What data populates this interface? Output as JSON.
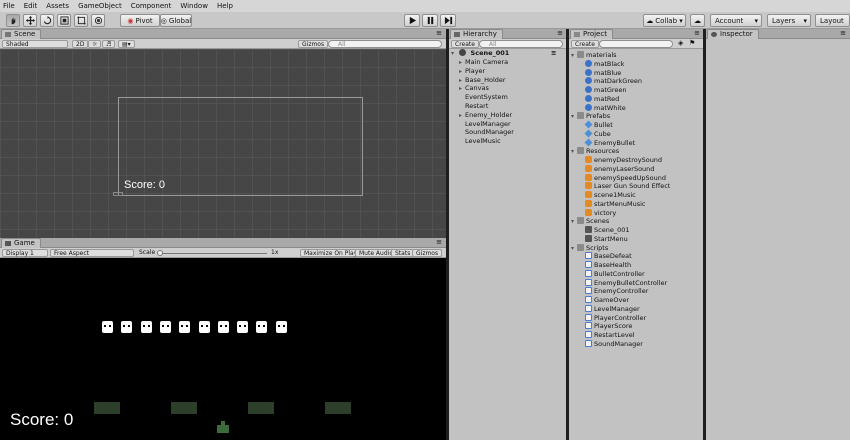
{
  "menu": [
    "File",
    "Edit",
    "Assets",
    "GameObject",
    "Component",
    "Window",
    "Help"
  ],
  "toolbar": {
    "pivot": "Pivot",
    "global": "Global",
    "collab": "Collab ▾",
    "account": "Account",
    "layers": "Layers",
    "layout": "Layout"
  },
  "scene": {
    "tab": "Scene",
    "shading": "Shaded",
    "mode2d": "2D",
    "gizmos": "Gizmos",
    "search_placeholder": "All",
    "score_text": "Score: 0"
  },
  "game": {
    "tab": "Game",
    "display": "Display 1",
    "aspect": "Free Aspect",
    "scale_label": "Scale",
    "scale_value": "1x",
    "maximize": "Maximize On Play",
    "mute": "Mute Audio",
    "stats": "Stats",
    "gizmos": "Gizmos",
    "score_text": "Score: 0",
    "enemy_count": 10,
    "bunker_count": 4
  },
  "hierarchy": {
    "tab": "Hierarchy",
    "create": "Create",
    "search_placeholder": "All",
    "scene_name": "Scene_001",
    "items": [
      {
        "label": "Main Camera",
        "expandable": true
      },
      {
        "label": "Player",
        "expandable": true
      },
      {
        "label": "Base_Holder",
        "expandable": true
      },
      {
        "label": "Canvas",
        "expandable": true
      },
      {
        "label": "EventSystem",
        "expandable": false
      },
      {
        "label": "Restart",
        "expandable": false
      },
      {
        "label": "Enemy_Holder",
        "expandable": true
      },
      {
        "label": "LevelManager",
        "expandable": false
      },
      {
        "label": "SoundManager",
        "expandable": false
      },
      {
        "label": "LevelMusic",
        "expandable": false
      }
    ]
  },
  "project": {
    "tab": "Project",
    "create": "Create",
    "tree": [
      {
        "label": "materials",
        "type": "folder",
        "depth": 0
      },
      {
        "label": "matBlack",
        "type": "material",
        "depth": 1
      },
      {
        "label": "matBlue",
        "type": "material",
        "depth": 1
      },
      {
        "label": "matDarkGreen",
        "type": "material",
        "depth": 1
      },
      {
        "label": "matGreen",
        "type": "material",
        "depth": 1
      },
      {
        "label": "matRed",
        "type": "material",
        "depth": 1
      },
      {
        "label": "matWhite",
        "type": "material",
        "depth": 1
      },
      {
        "label": "Prefabs",
        "type": "folder",
        "depth": 0
      },
      {
        "label": "Bullet",
        "type": "prefab",
        "depth": 1
      },
      {
        "label": "Cube",
        "type": "prefab",
        "depth": 1
      },
      {
        "label": "EnemyBullet",
        "type": "prefab",
        "depth": 1
      },
      {
        "label": "Resources",
        "type": "folder",
        "depth": 0
      },
      {
        "label": "enemyDestroySound",
        "type": "audio",
        "depth": 1
      },
      {
        "label": "enemyLaserSound",
        "type": "audio",
        "depth": 1
      },
      {
        "label": "enemySpeedUpSound",
        "type": "audio",
        "depth": 1
      },
      {
        "label": "Laser Gun Sound Effect",
        "type": "audio",
        "depth": 1
      },
      {
        "label": "scene1Music",
        "type": "audio",
        "depth": 1
      },
      {
        "label": "startMenuMusic",
        "type": "audio",
        "depth": 1
      },
      {
        "label": "victory",
        "type": "audio",
        "depth": 1
      },
      {
        "label": "Scenes",
        "type": "folder",
        "depth": 0
      },
      {
        "label": "Scene_001",
        "type": "scene",
        "depth": 1
      },
      {
        "label": "StartMenu",
        "type": "scene",
        "depth": 1
      },
      {
        "label": "Scripts",
        "type": "folder",
        "depth": 0
      },
      {
        "label": "BaseDefeat",
        "type": "script",
        "depth": 1
      },
      {
        "label": "BaseHealth",
        "type": "script",
        "depth": 1
      },
      {
        "label": "BulletController",
        "type": "script",
        "depth": 1
      },
      {
        "label": "EnemyBulletController",
        "type": "script",
        "depth": 1
      },
      {
        "label": "EnemyController",
        "type": "script",
        "depth": 1
      },
      {
        "label": "GameOver",
        "type": "script",
        "depth": 1
      },
      {
        "label": "LevelManager",
        "type": "script",
        "depth": 1
      },
      {
        "label": "PlayerController",
        "type": "script",
        "depth": 1
      },
      {
        "label": "PlayerScore",
        "type": "script",
        "depth": 1
      },
      {
        "label": "RestartLevel",
        "type": "script",
        "depth": 1
      },
      {
        "label": "SoundManager",
        "type": "script",
        "depth": 1
      }
    ]
  },
  "inspector": {
    "tab": "Inspector"
  }
}
